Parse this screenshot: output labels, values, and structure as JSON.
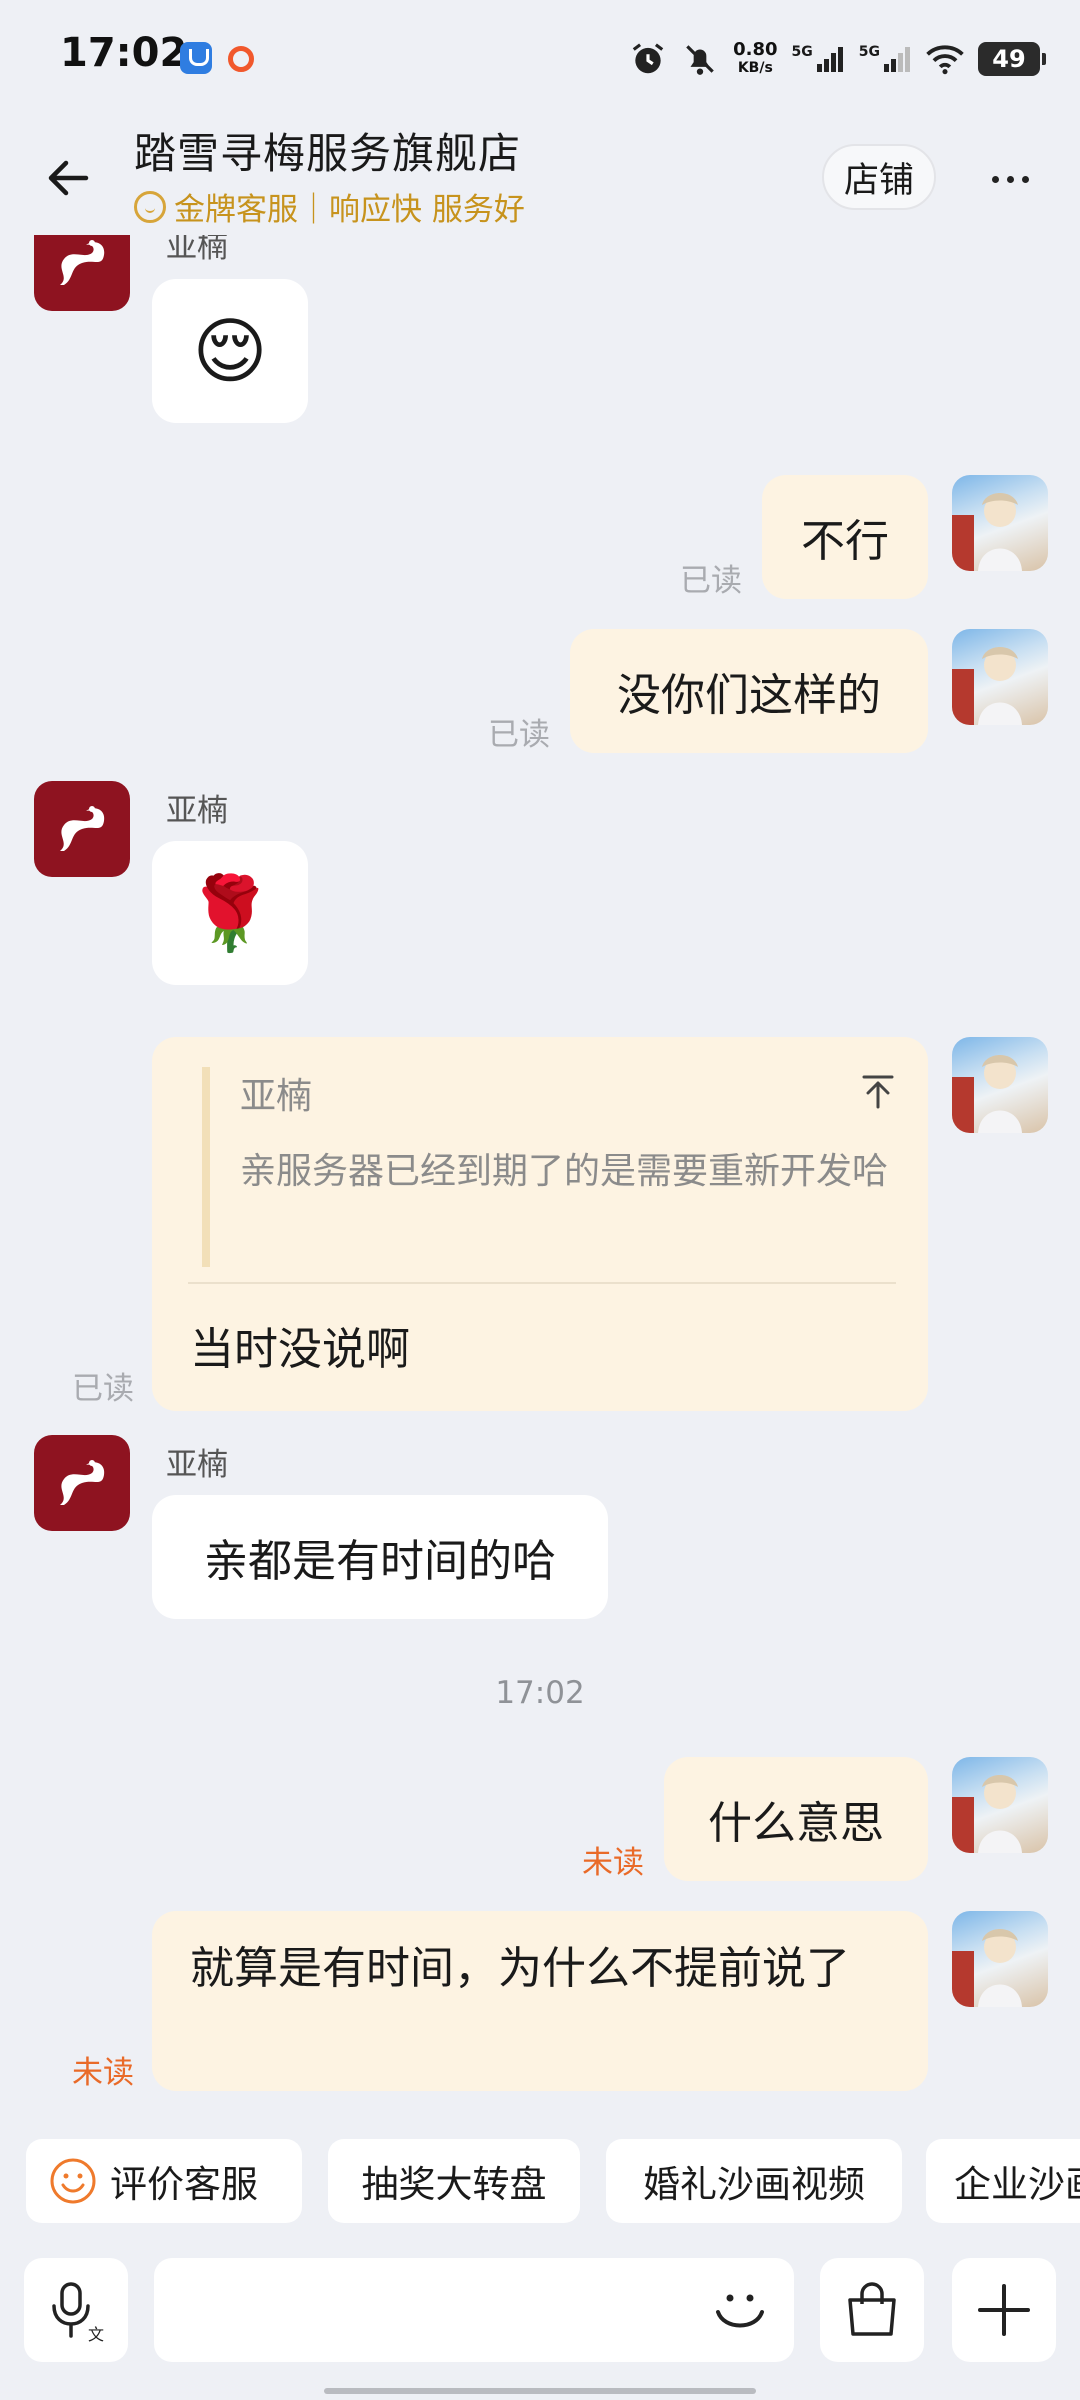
{
  "status_bar": {
    "time": "17:02",
    "net_speed_value": "0.80",
    "net_speed_unit": "KB/s",
    "sim1": "5G",
    "sim2": "5G",
    "battery": "49"
  },
  "header": {
    "title": "踏雪寻梅服务旗舰店",
    "subtitle": "金牌客服｜响应快 服务好",
    "shop_button": "店铺"
  },
  "messages": {
    "m1": {
      "sender": "亚楠",
      "content": "😌"
    },
    "m2": {
      "content": "不行",
      "status": "已读"
    },
    "m3": {
      "content": "没你们这样的",
      "status": "已读"
    },
    "m4": {
      "sender": "亚楠",
      "content": "🌹"
    },
    "m5": {
      "quote_sender": "亚楠",
      "quote_text": "亲服务器已经到期了的是需要重新开发哈",
      "content": "当时没说啊",
      "status": "已读"
    },
    "m6": {
      "sender": "亚楠",
      "content": "亲都是有时间的哈"
    },
    "time_separator": "17:02",
    "m7": {
      "content": "什么意思",
      "status": "未读"
    },
    "m8": {
      "content": "就算是有时间，为什么不提前说了",
      "status": "未读"
    }
  },
  "quick_actions": [
    "评价客服",
    "抽奖大转盘",
    "婚礼沙画视频",
    "企业沙画"
  ],
  "colors": {
    "background": "#eef0f5",
    "bubble_out": "#fdf3e2",
    "bubble_in": "#ffffff",
    "gold": "#c7931d",
    "unread": "#e96a28",
    "read": "#a9abb0"
  }
}
